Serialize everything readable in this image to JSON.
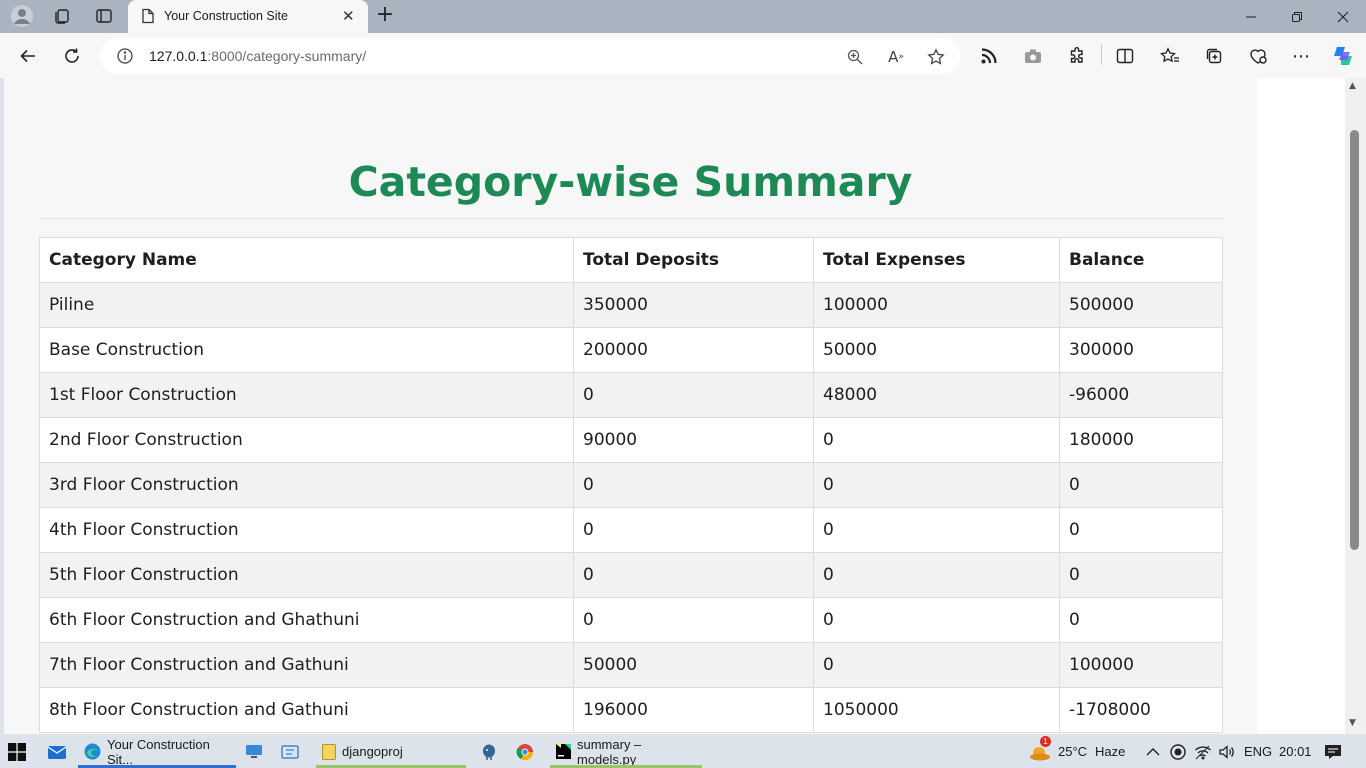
{
  "browser": {
    "tab_title": "Your Construction Site",
    "url_host": "127.0.0.1",
    "url_path": ":8000/category-summary/"
  },
  "page": {
    "title": "Category-wise Summary",
    "columns": [
      "Category Name",
      "Total Deposits",
      "Total Expenses",
      "Balance"
    ],
    "rows": [
      [
        "Piline",
        "350000",
        "100000",
        "500000"
      ],
      [
        "Base Construction",
        "200000",
        "50000",
        "300000"
      ],
      [
        "1st Floor Construction",
        "0",
        "48000",
        "-96000"
      ],
      [
        "2nd Floor Construction",
        "90000",
        "0",
        "180000"
      ],
      [
        "3rd Floor Construction",
        "0",
        "0",
        "0"
      ],
      [
        "4th Floor Construction",
        "0",
        "0",
        "0"
      ],
      [
        "5th Floor Construction",
        "0",
        "0",
        "0"
      ],
      [
        "6th Floor Construction and Ghathuni",
        "0",
        "0",
        "0"
      ],
      [
        "7th Floor Construction and Gathuni",
        "50000",
        "0",
        "100000"
      ],
      [
        "8th Floor Construction and Gathuni",
        "196000",
        "1050000",
        "-1708000"
      ]
    ],
    "title_color": "#1d8a55"
  },
  "taskbar": {
    "browser_window": "Your Construction Sit...",
    "folder_window": "djangoproj",
    "pycharm_window": "summary – models.py",
    "weather_temp": "25°C",
    "weather_desc": "Haze",
    "weather_badge": "1",
    "language": "ENG",
    "clock": "20:01"
  },
  "icons": [
    "profile-icon",
    "workspaces-icon",
    "tab-actions-icon",
    "page-icon",
    "close-icon",
    "plus-icon",
    "minimize-icon",
    "restore-icon",
    "back-icon",
    "refresh-icon",
    "info-icon",
    "zoom-icon",
    "read-aloud-icon",
    "favorite-star-icon",
    "rss-icon",
    "camera-icon",
    "extensions-icon",
    "split-screen-icon",
    "favorites-icon",
    "collections-icon",
    "performance-icon",
    "more-icon",
    "copilot-icon",
    "windows-start-icon",
    "mail-icon",
    "edge-icon",
    "computer-icon",
    "app-icon",
    "folder-icon",
    "postgres-icon",
    "chrome-icon",
    "pycharm-icon",
    "chevron-up-icon",
    "record-icon",
    "wifi-icon",
    "volume-icon",
    "notification-icon"
  ]
}
